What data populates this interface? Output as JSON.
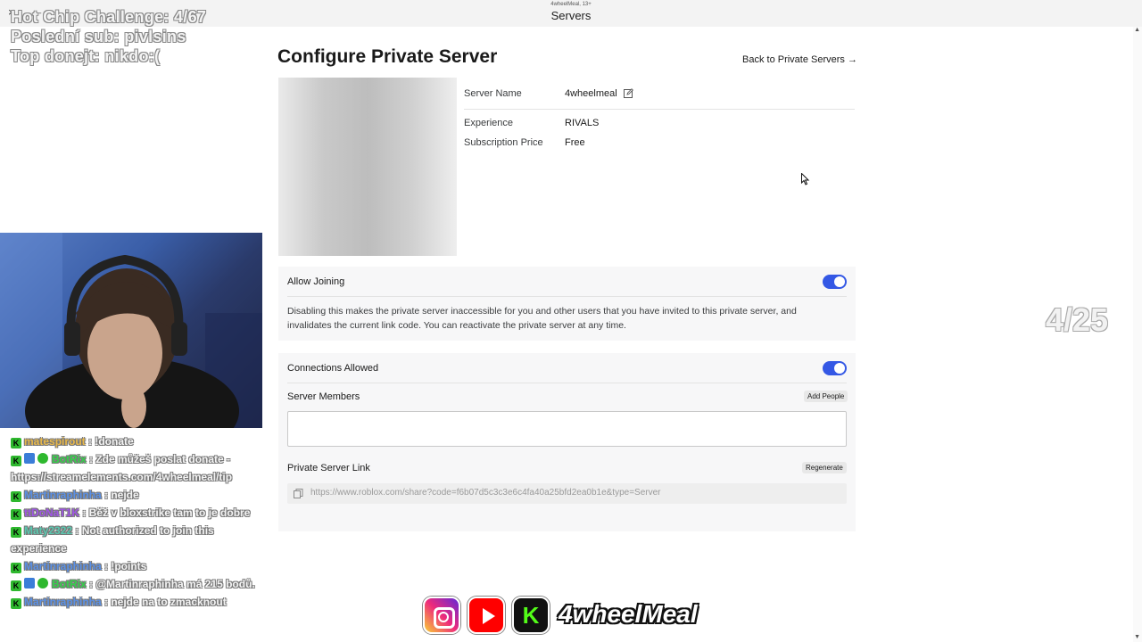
{
  "window": {
    "subtitle": "4wheelMeal, 13+",
    "title": "Servers",
    "close_icon": "×",
    "back_icon": "←"
  },
  "overlay": {
    "line1": "Hot Chip Challenge: 4/67",
    "line2": "Poslední sub: pivlsins",
    "line3": "Top donejt: nikdo:(",
    "counter": "4/25"
  },
  "chat": {
    "messages": [
      {
        "user": "matespirout",
        "text": " : !donate"
      },
      {
        "user": "BotRix",
        "text": " : Zde můžeš poslat donate - https://streamelements.com/4wheelmeal/tip"
      },
      {
        "user": "Martinraphinha",
        "text": " : nejde"
      },
      {
        "user": "ttDoNaT1K",
        "text": " : Běž v bloxstrike tam to je dobre"
      },
      {
        "user": "Maty2322",
        "text": " : Not authorized to join this experience"
      },
      {
        "user": "Martinraphinha",
        "text": " : !points"
      },
      {
        "user": "BotRix",
        "text": " : @Martinraphinha má 215 bodů."
      },
      {
        "user": "Martinraphinha",
        "text": " : nejde na to zmacknout"
      }
    ]
  },
  "page": {
    "heading": "Configure Private Server",
    "back_link": "Back to Private Servers →",
    "server_name_label": "Server Name",
    "server_name_value": "4wheelmeal",
    "experience_label": "Experience",
    "experience_value": "RIVALS",
    "price_label": "Subscription Price",
    "price_value": "Free",
    "allow_joining_label": "Allow Joining",
    "allow_joining_on": true,
    "allow_joining_desc": "Disabling this makes the private server inaccessible for you and other users that you have invited to this private server, and invalidates the current link code. You can reactivate the private server at any time.",
    "connections_label": "Connections Allowed",
    "connections_on": true,
    "members_label": "Server Members",
    "add_people_label": "Add People",
    "link_label": "Private Server Link",
    "regenerate_label": "Regenerate",
    "link_url": "https://www.roblox.com/share?code=f6b07d5c3c3e6c4fa40a25bfd2ea0b1e&type=Server",
    "accent_color": "#3458e5"
  },
  "socials": {
    "kick_letter": "K",
    "channel": "4wheelMeal"
  }
}
